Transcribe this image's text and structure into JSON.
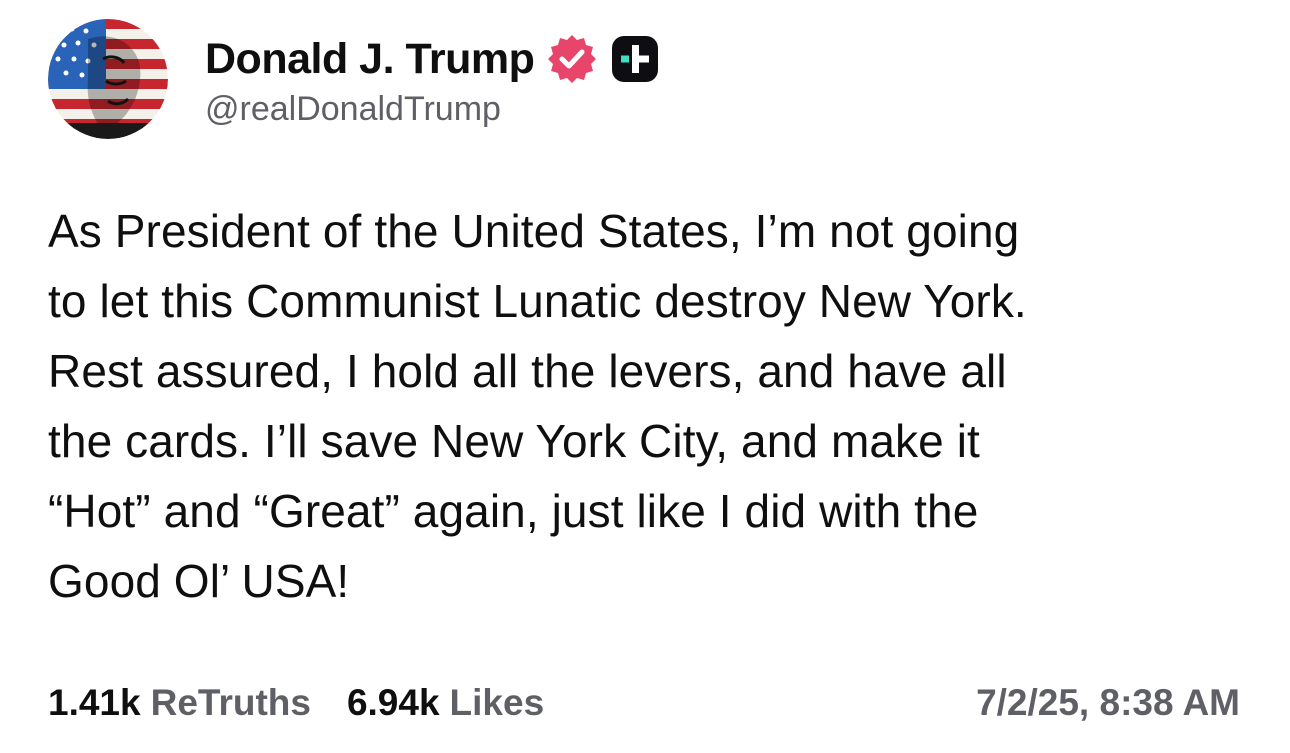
{
  "author": {
    "display_name": "Donald J. Trump",
    "handle": "@realDonaldTrump",
    "avatar_icon": "flag-portrait-avatar",
    "verified_icon": "verified-badge-icon",
    "plus_icon": "truth-plus-badge-icon"
  },
  "post": {
    "text": "As President of the United States, I’m not going\nto let this Communist Lunatic destroy New York.\nRest assured, I hold all the levers, and have all\nthe cards. I’ll save New York City, and make it\n“Hot” and “Great” again, just like I did with the\nGood Ol’ USA!"
  },
  "stats": {
    "retruths_count": "1.41k",
    "retruths_label": "ReTruths",
    "likes_count": "6.94k",
    "likes_label": "Likes",
    "timestamp": "7/2/25, 8:38 AM"
  },
  "colors": {
    "verified": "#e8456b",
    "plus_badge_bg": "#0d0d12",
    "plus_badge_accent": "#3ee0c4",
    "secondary_text": "#5f5f66"
  }
}
